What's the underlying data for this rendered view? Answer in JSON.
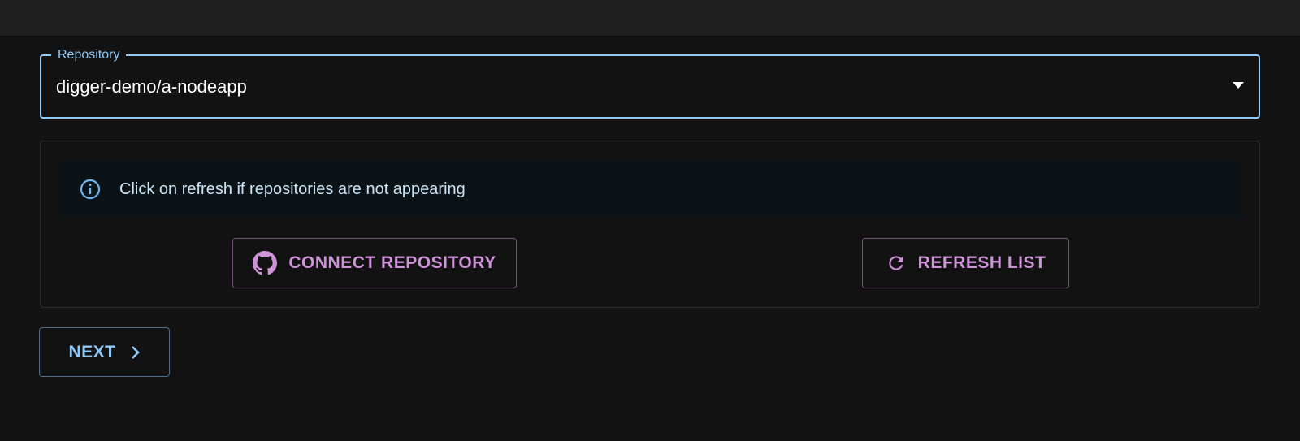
{
  "repository_select": {
    "label": "Repository",
    "value": "digger-demo/a-nodeapp",
    "arrow_icon": "caret-down-icon"
  },
  "info_alert": {
    "icon": "info-icon",
    "message": "Click on refresh if repositories are not appearing"
  },
  "actions": {
    "connect_label": "CONNECT REPOSITORY",
    "connect_icon": "github-icon",
    "refresh_label": "REFRESH LIST",
    "refresh_icon": "refresh-icon"
  },
  "navigation": {
    "next_label": "NEXT",
    "next_icon": "chevron-right-icon"
  },
  "colors": {
    "background": "#121212",
    "primary": "#90caf9",
    "secondary": "#ce93d8",
    "info_text": "#c8e4f5",
    "alert_background": "#0b1317"
  }
}
